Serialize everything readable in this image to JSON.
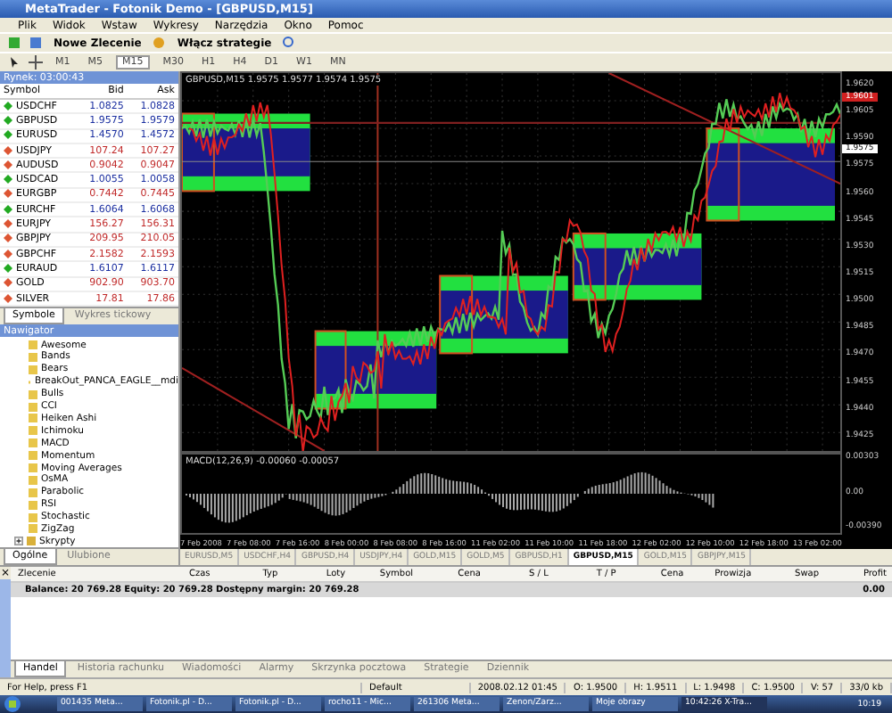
{
  "window": {
    "title": "MetaTrader - Fotonik Demo - [GBPUSD,M15]"
  },
  "menu": [
    "Plik",
    "Widok",
    "Wstaw",
    "Wykresy",
    "Narzędzia",
    "Okno",
    "Pomoc"
  ],
  "toolbar": {
    "new_order": "Nowe Zlecenie",
    "strategies": "Włącz strategie"
  },
  "timeframes": [
    {
      "label": "M1",
      "selected": false
    },
    {
      "label": "M5",
      "selected": false
    },
    {
      "label": "M15",
      "selected": true
    },
    {
      "label": "M30",
      "selected": false
    },
    {
      "label": "H1",
      "selected": false
    },
    {
      "label": "H4",
      "selected": false
    },
    {
      "label": "D1",
      "selected": false
    },
    {
      "label": "W1",
      "selected": false
    },
    {
      "label": "MN",
      "selected": false
    }
  ],
  "market_watch": {
    "title": "Rynek: 03:00:43",
    "columns": [
      "Symbol",
      "Bid",
      "Ask"
    ],
    "rows": [
      {
        "symbol": "USDCHF",
        "bid": "1.0825",
        "ask": "1.0828",
        "color": "#22aa22"
      },
      {
        "symbol": "GBPUSD",
        "bid": "1.9575",
        "ask": "1.9579",
        "color": "#22aa22"
      },
      {
        "symbol": "EURUSD",
        "bid": "1.4570",
        "ask": "1.4572",
        "color": "#22aa22"
      },
      {
        "symbol": "USDJPY",
        "bid": "107.24",
        "ask": "107.27",
        "color": "#dd5533"
      },
      {
        "symbol": "AUDUSD",
        "bid": "0.9042",
        "ask": "0.9047",
        "color": "#dd5533"
      },
      {
        "symbol": "USDCAD",
        "bid": "1.0055",
        "ask": "1.0058",
        "color": "#22aa22"
      },
      {
        "symbol": "EURGBP",
        "bid": "0.7442",
        "ask": "0.7445",
        "color": "#dd5533"
      },
      {
        "symbol": "EURCHF",
        "bid": "1.6064",
        "ask": "1.6068",
        "color": "#22aa22"
      },
      {
        "symbol": "EURJPY",
        "bid": "156.27",
        "ask": "156.31",
        "color": "#dd5533"
      },
      {
        "symbol": "GBPJPY",
        "bid": "209.95",
        "ask": "210.05",
        "color": "#dd5533"
      },
      {
        "symbol": "GBPCHF",
        "bid": "2.1582",
        "ask": "2.1593",
        "color": "#dd5533"
      },
      {
        "symbol": "EURAUD",
        "bid": "1.6107",
        "ask": "1.6117",
        "color": "#22aa22"
      },
      {
        "symbol": "GOLD",
        "bid": "902.90",
        "ask": "903.70",
        "color": "#dd5533"
      },
      {
        "symbol": "SILVER",
        "bid": "17.81",
        "ask": "17.86",
        "color": "#dd5533"
      }
    ],
    "tabs": [
      {
        "label": "Symbole",
        "selected": true
      },
      {
        "label": "Wykres tickowy",
        "selected": false
      }
    ]
  },
  "navigator": {
    "title": "Nawigator",
    "indicators": [
      "Awesome",
      "Bands",
      "Bears",
      "BreakOut_PANCA_EAGLE__mdi",
      "Bulls",
      "CCI",
      "Heiken Ashi",
      "Ichimoku",
      "MACD",
      "Momentum",
      "Moving Averages",
      "OsMA",
      "Parabolic",
      "RSI",
      "Stochastic",
      "ZigZag"
    ],
    "folders": [
      {
        "label": "Skrypty",
        "expanded": false
      }
    ],
    "tabs": [
      {
        "label": "Ogólne",
        "selected": true
      },
      {
        "label": "Ulubione",
        "selected": false
      }
    ]
  },
  "chart": {
    "header": "GBPUSD,M15  1.9575 1.9577 1.9574 1.9575",
    "price_labels": [
      "1.9620",
      "1.9605",
      "1.9590",
      "1.9575",
      "1.9560",
      "1.9545",
      "1.9530",
      "1.9515",
      "1.9500",
      "1.9485",
      "1.9470",
      "1.9455",
      "1.9440",
      "1.9425"
    ],
    "bid_marker": "1.9575",
    "line_marker": "1.9601",
    "macd_label": "MACD(12,26,9) -0.00060 -0.00057",
    "macd_labels": [
      "0.00303",
      "0.00",
      "-0.00390"
    ],
    "time_labels": [
      "7 Feb 2008",
      "7 Feb 08:00",
      "7 Feb 16:00",
      "8 Feb 00:00",
      "8 Feb 08:00",
      "8 Feb 16:00",
      "11 Feb 02:00",
      "11 Feb 10:00",
      "11 Feb 18:00",
      "12 Feb 02:00",
      "12 Feb 10:00",
      "12 Feb 18:00",
      "13 Feb 02:00"
    ]
  },
  "chart_tabs": [
    {
      "label": "EURUSD,M5",
      "selected": false
    },
    {
      "label": "USDCHF,H4",
      "selected": false
    },
    {
      "label": "GBPUSD,H4",
      "selected": false
    },
    {
      "label": "USDJPY,H4",
      "selected": false
    },
    {
      "label": "GOLD,M15",
      "selected": false
    },
    {
      "label": "GOLD,M5",
      "selected": false
    },
    {
      "label": "GBPUSD,H1",
      "selected": false
    },
    {
      "label": "GBPUSD,M15",
      "selected": true
    },
    {
      "label": "GOLD,M15",
      "selected": false
    },
    {
      "label": "GBPJPY,M15",
      "selected": false
    }
  ],
  "terminal": {
    "close": "×",
    "columns": [
      "Zlecenie",
      "Czas",
      "Typ",
      "Loty",
      "Symbol",
      "Cena",
      "S / L",
      "T / P",
      "Cena",
      "Prowizja",
      "Swap",
      "Profit"
    ],
    "balance": "Balance: 20 769.28  Equity: 20 769.28  Dostępny margin: 20 769.28",
    "profit": "0.00",
    "tabs": [
      {
        "label": "Handel",
        "selected": true
      },
      {
        "label": "Historia rachunku",
        "selected": false
      },
      {
        "label": "Wiadomości",
        "selected": false
      },
      {
        "label": "Alarmy",
        "selected": false
      },
      {
        "label": "Skrzynka pocztowa",
        "selected": false
      },
      {
        "label": "Strategie",
        "selected": false
      },
      {
        "label": "Dziennik",
        "selected": false
      }
    ]
  },
  "status_bar": [
    "For Help, press F1",
    "Default",
    "2008.02.12 01:45",
    "O: 1.9500",
    "H: 1.9511",
    "L: 1.9498",
    "C: 1.9500",
    "V: 57",
    "33/0 kb"
  ],
  "taskbar": {
    "items": [
      {
        "label": "001435 Meta...",
        "selected": false
      },
      {
        "label": "Fotonik.pl - D...",
        "selected": false
      },
      {
        "label": "Fotonik.pl - D...",
        "selected": false
      },
      {
        "label": "rocho11 - Mic...",
        "selected": false
      },
      {
        "label": "261306 Meta...",
        "selected": false
      },
      {
        "label": "Zenon/Zarz...",
        "selected": false
      },
      {
        "label": "Moje obrazy",
        "selected": false
      },
      {
        "label": "10:42:26 X-Tra...",
        "selected": true
      }
    ],
    "clock": "10:19"
  }
}
